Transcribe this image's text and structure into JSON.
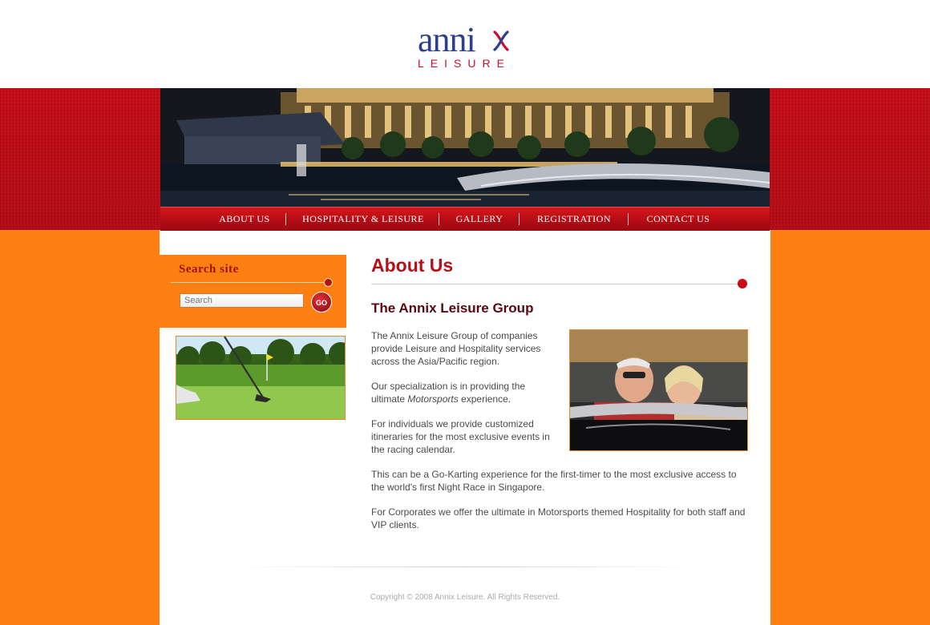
{
  "brand": {
    "logo_word": "anni",
    "logo_sub": "LEISURE",
    "colors": {
      "navy": "#2b3f8f",
      "red": "#c8102e",
      "orange": "#ff8012"
    }
  },
  "nav": {
    "items": [
      {
        "label": "ABOUT US"
      },
      {
        "label": "HOSPITALITY & LEISURE"
      },
      {
        "label": "GALLERY"
      },
      {
        "label": "REGISTRATION"
      },
      {
        "label": "CONTACT US"
      }
    ]
  },
  "search": {
    "title": "Search site",
    "placeholder": "Search",
    "go_label": "GO"
  },
  "main": {
    "heading": "About Us",
    "subheading": "The Annix Leisure Group",
    "paragraphs": [
      "The Annix Leisure Group of companies provide Leisure and Hospitality services across the Asia/Pacific region.",
      {
        "before": "Our specialization is in providing the ultimate ",
        "em": "Motorsports",
        "after": " experience."
      },
      "For individuals we provide customized itineraries for the most exclusive events in the racing calendar.",
      "This can be a Go-Karting experience for the first-timer to the most exclusive access to the world's first Night Race in Singapore.",
      "For Corporates we offer the ultimate in Motorsports themed Hospitality for both staff and VIP clients."
    ]
  },
  "footer": {
    "copyright": "Copyright © 2008 Annix Leisure. All Rights Reserved."
  }
}
